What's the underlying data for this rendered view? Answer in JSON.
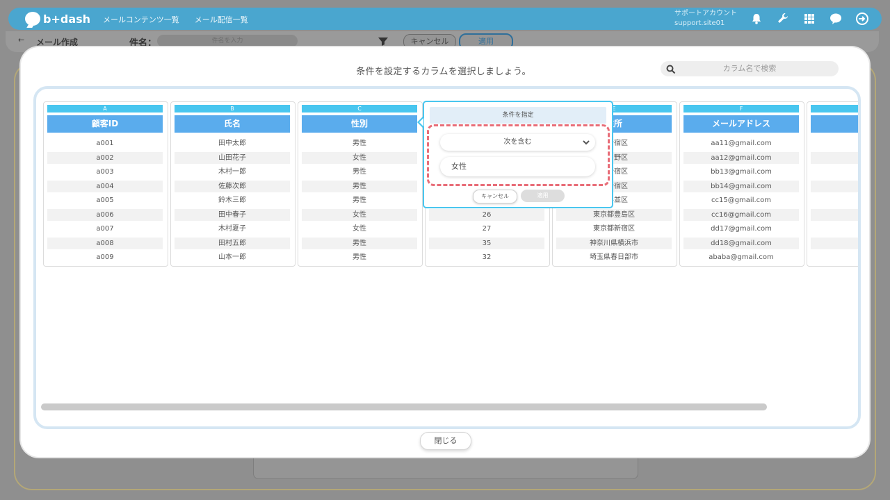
{
  "app": {
    "logo_text": "b+dash",
    "nav": [
      "メールコンテンツ一覧",
      "メール配信一覧"
    ],
    "account_label": "サポートアカウント",
    "account_site": "support.site01"
  },
  "subheader": {
    "back_arrow": "←",
    "page_title": "メール作成",
    "subject_label": "件名：",
    "subject_placeholder": "件名を入力",
    "cancel_label": "キャンセル",
    "apply_label": "適用"
  },
  "modal": {
    "title": "条件を設定するカラムを選択しましょう。",
    "search_placeholder": "カラム名で検索",
    "close_label": "閉じる",
    "columns": [
      {
        "letter": "A",
        "header": "顧客ID",
        "cells": [
          "a001",
          "a002",
          "a003",
          "a004",
          "a005",
          "a006",
          "a007",
          "a008",
          "a009"
        ]
      },
      {
        "letter": "B",
        "header": "氏名",
        "cells": [
          "田中太郎",
          "山田花子",
          "木村一郎",
          "佐藤次郎",
          "鈴木三郎",
          "田中春子",
          "木村夏子",
          "田村五郎",
          "山本一郎"
        ]
      },
      {
        "letter": "C",
        "header": "性別",
        "cells": [
          "男性",
          "女性",
          "男性",
          "男性",
          "男性",
          "女性",
          "女性",
          "男性",
          "男性"
        ]
      },
      {
        "letter": "",
        "header": "",
        "cells": [
          "",
          "",
          "",
          "",
          "",
          "26",
          "27",
          "35",
          "32"
        ]
      },
      {
        "letter": "E",
        "header": "住所",
        "cells": [
          "都新宿区",
          "都中野区",
          "都新宿区",
          "都新宿区",
          "都杉並区",
          "東京都豊島区",
          "東京都新宿区",
          "神奈川県横浜市",
          "埼玉県春日部市"
        ]
      },
      {
        "letter": "F",
        "header": "メールアドレス",
        "cells": [
          "aa11@gmail.com",
          "aa12@gmail.com",
          "bb13@gmail.com",
          "bb14@gmail.com",
          "cc15@gmail.com",
          "cc16@gmail.com",
          "dd17@gmail.com",
          "dd18@gmail.com",
          "ababa@gmail.com"
        ]
      },
      {
        "letter": "",
        "header": "",
        "cells": [
          "",
          "",
          "",
          "",
          "",
          "",
          "",
          "",
          ""
        ]
      }
    ]
  },
  "popover": {
    "title": "条件を指定",
    "operator": "次を含む",
    "value": "女性",
    "cancel_label": "キャンセル",
    "apply_label": "適用"
  },
  "colors": {
    "accent": "#49c6ef",
    "header_blue": "#5aaced",
    "highlight_dash": "#e86d78",
    "topbar": "#4aa6cf"
  }
}
